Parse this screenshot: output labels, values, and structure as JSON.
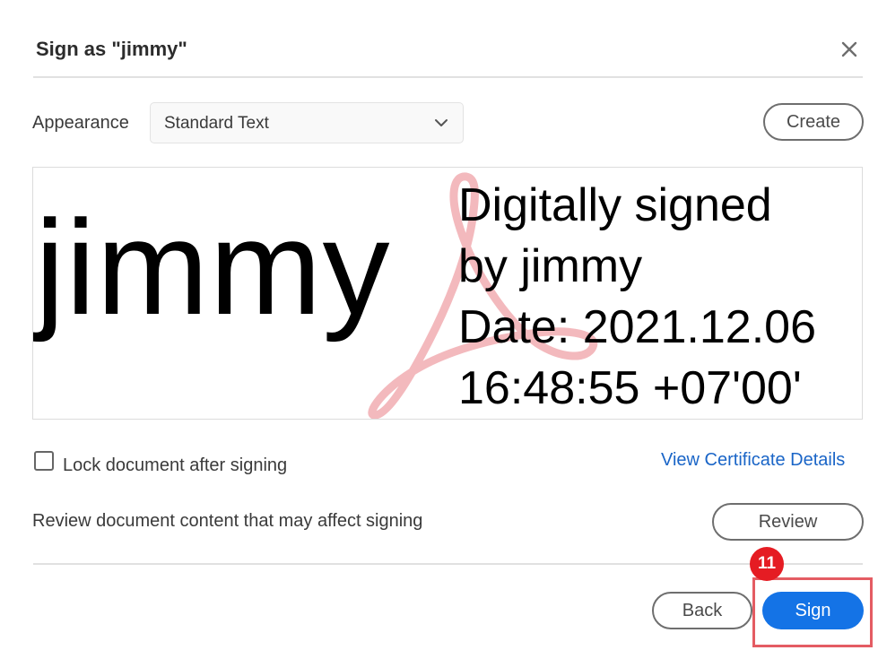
{
  "dialog": {
    "title": "Sign as \"jimmy\"",
    "close_icon": "close-icon"
  },
  "appearance": {
    "label": "Appearance",
    "selected_value": "Standard Text",
    "create_label": "Create"
  },
  "preview": {
    "name": "jimmy",
    "details_lines": [
      "Digitally signed",
      "by jimmy",
      "Date: 2021.12.06",
      "16:48:55 +07'00'"
    ],
    "watermark_icon": "acrobat-logo-watermark",
    "watermark_color": "#f3b9bd"
  },
  "lock": {
    "label": "Lock document after signing",
    "checked": false
  },
  "certificate_link": "View Certificate Details",
  "review": {
    "text": "Review document content that may affect signing",
    "button_label": "Review"
  },
  "footer": {
    "back_label": "Back",
    "sign_label": "Sign"
  },
  "annotation": {
    "step_number": "11",
    "highlight_color": "#e45c63",
    "badge_color": "#e51c23"
  },
  "colors": {
    "accent": "#1473e6",
    "link": "#1a65c7"
  }
}
